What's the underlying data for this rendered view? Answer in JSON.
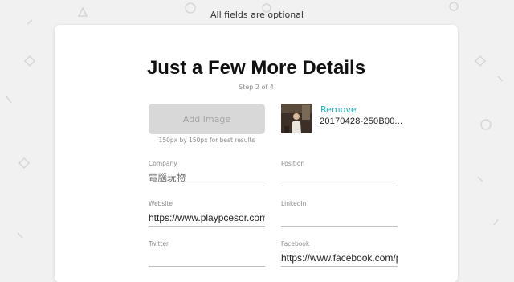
{
  "header": {
    "note": "All fields are optional"
  },
  "card": {
    "title": "Just a Few More Details",
    "step": "Step 2 of 4"
  },
  "image": {
    "add_label": "Add Image",
    "hint": "150px by 150px for best results",
    "remove_label": "Remove",
    "filename": "20170428-250B00..."
  },
  "fields": {
    "company": {
      "label": "Company",
      "value": "電腦玩物"
    },
    "position": {
      "label": "Position",
      "value": ""
    },
    "website": {
      "label": "Website",
      "value": "https://www.playpcesor.com/"
    },
    "linkedin": {
      "label": "LinkedIn",
      "value": ""
    },
    "twitter": {
      "label": "Twitter",
      "value": ""
    },
    "facebook": {
      "label": "Facebook",
      "value": "https://www.facebook.com/pl"
    }
  },
  "colors": {
    "accent": "#1ab3b5",
    "button_bg": "#d8d8d8",
    "page_bg": "#f1f1f1"
  }
}
